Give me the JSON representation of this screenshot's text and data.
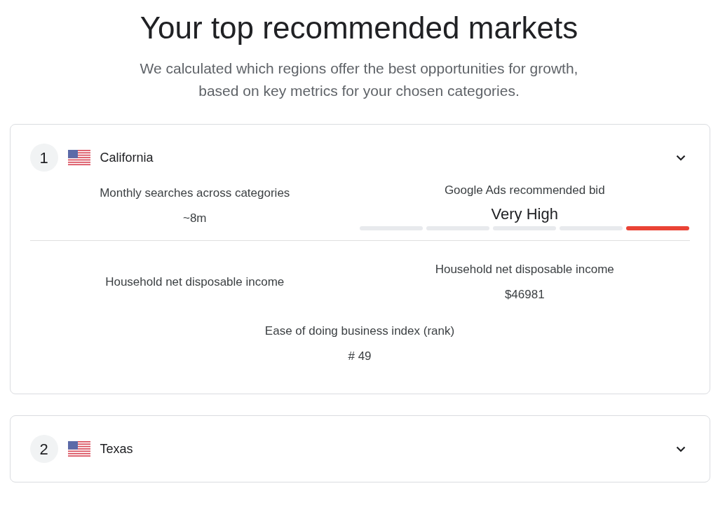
{
  "heading": "Your top recommended markets",
  "subheading": "We calculated which regions offer the best opportunities for growth, based on key metrics for your chosen categories.",
  "markets": [
    {
      "rank": "1",
      "name": "California",
      "expanded": true,
      "sections": [
        [
          {
            "kind": "text",
            "label": "Monthly searches across categories",
            "value": "~8m"
          },
          {
            "kind": "meter",
            "label": "Google Ads recommended bid",
            "value": "Very High",
            "segments": [
              {
                "on": false
              },
              {
                "on": false
              },
              {
                "on": false
              },
              {
                "on": false
              },
              {
                "on": true
              }
            ]
          }
        ],
        [
          {
            "kind": "text",
            "label": "Household net disposable income"
          },
          {
            "kind": "text",
            "label": "Household net disposable income",
            "value": "$46981"
          },
          {
            "kind": "text",
            "label": "Ease of doing business index (rank)",
            "value": "# 49"
          }
        ]
      ]
    },
    {
      "rank": "2",
      "name": "Texas",
      "expanded": false
    }
  ]
}
